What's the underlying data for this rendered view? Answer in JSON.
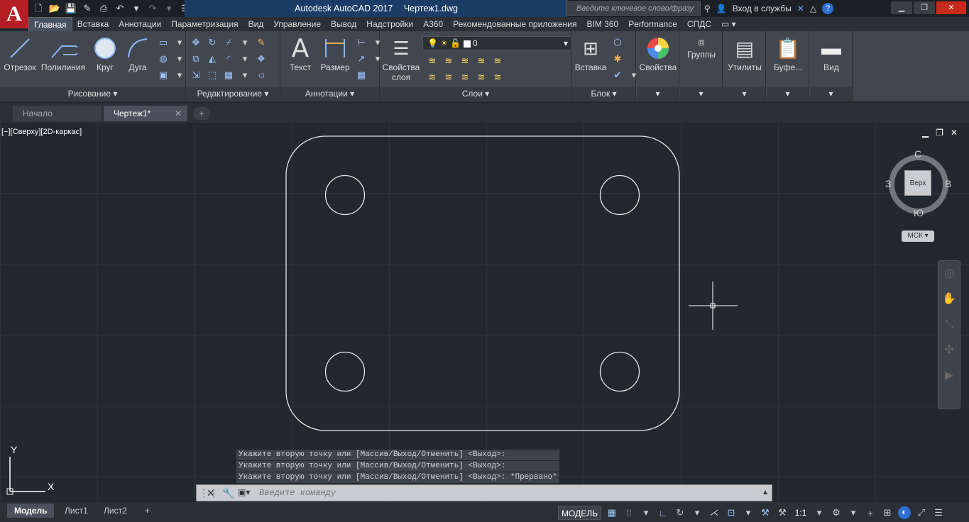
{
  "app": {
    "logo": "A",
    "title_app": "Autodesk AutoCAD 2017",
    "title_file": "Чертеж1.dwg",
    "search_placeholder": "Введите ключевое слово/фразу",
    "signin": "Вход в службы",
    "help": "?"
  },
  "ribbon_tabs": [
    "Главная",
    "Вставка",
    "Аннотации",
    "Параметризация",
    "Вид",
    "Управление",
    "Вывод",
    "Надстройки",
    "A360",
    "Рекомендованные приложения",
    "BIM 360",
    "Performance",
    "СПДС"
  ],
  "draw_panel": {
    "title": "Рисование",
    "line": "Отрезок",
    "polyline": "Полилиния",
    "circle": "Круг",
    "arc": "Дуга"
  },
  "modify_panel": {
    "title": "Редактирование"
  },
  "annot_panel": {
    "title": "Аннотации",
    "text": "Текст",
    "dim": "Размер"
  },
  "layers_panel": {
    "title": "Слои",
    "props_label": "Свойства",
    "props_label2": "слоя",
    "current_layer": "0"
  },
  "block_panel": {
    "title": "Блок",
    "insert": "Вставка"
  },
  "props_panel": {
    "label": "Свойства"
  },
  "groups_panel": {
    "label": "Группы"
  },
  "utils_panel": {
    "label": "Утилиты"
  },
  "clip_panel": {
    "label": "Буфе..."
  },
  "view_panel": {
    "label": "Вид"
  },
  "doc_tabs": {
    "start": "Начало",
    "drawing": "Чертеж1*"
  },
  "viewport": {
    "label": "[−][Сверху][2D-каркас]"
  },
  "viewcube": {
    "north": "С",
    "south": "Ю",
    "west": "З",
    "east": "В",
    "face": "Верх",
    "ucs": "МСК"
  },
  "command": {
    "history": [
      "Укажите вторую точку или [Массив/Выход/Отменить] <Выход>:",
      "Укажите вторую точку или [Массив/Выход/Отменить] <Выход>:",
      "Укажите вторую точку или [Массив/Выход/Отменить] <Выход>: *Прервано*"
    ],
    "placeholder": "Введите команду"
  },
  "ucs_axes": {
    "x": "X",
    "y": "Y"
  },
  "layout_tabs": {
    "model": "Модель",
    "sheet1": "Лист1",
    "sheet2": "Лист2"
  },
  "status": {
    "model": "МОДЕЛЬ",
    "scale": "1:1"
  }
}
